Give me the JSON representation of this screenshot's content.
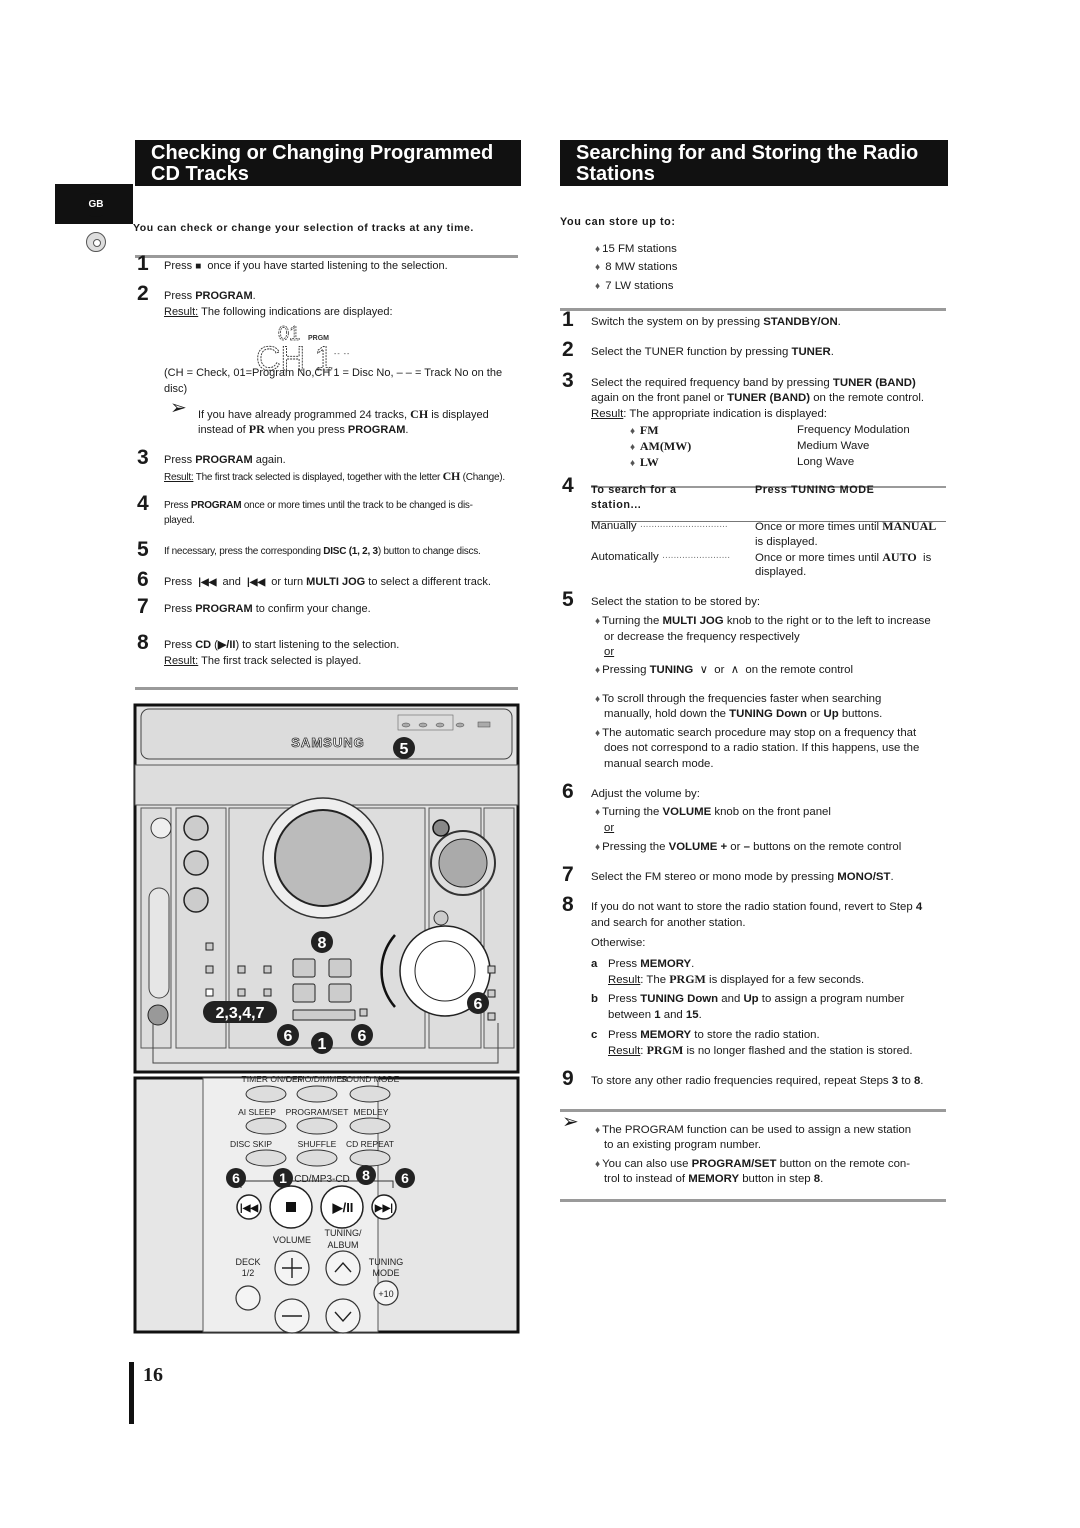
{
  "side": {
    "language_badge": "GB",
    "disc_icon": "cd-icon"
  },
  "left": {
    "title_line1": "Checking or Changing Programmed",
    "title_line2": "CD Tracks",
    "intro": "You can check or change your selection of tracks at any time.",
    "display": {
      "program_no": "01",
      "indicator": "PRGM",
      "check": "CH 1",
      "track": "-- --"
    },
    "lines": [
      [
        [
          "1",
          "num"
        ]
      ],
      [
        [
          "Press ",
          ""
        ],
        [
          "■",
          "icon"
        ],
        [
          "  once if you have started listening to the selection.",
          ""
        ]
      ],
      [
        [
          "2",
          "num"
        ]
      ],
      [
        [
          "Press ",
          ""
        ],
        [
          "PROGRAM",
          "b"
        ],
        [
          ".",
          ""
        ]
      ],
      [
        [
          "Result:",
          "u"
        ],
        [
          " The following indications are displayed:",
          ""
        ]
      ],
      [
        [
          "(CH = Check, 01=Program No,CH 1 = Disc No, – – = Track No on the",
          ""
        ]
      ],
      [
        [
          "disc)",
          ""
        ]
      ],
      [
        [
          "➢",
          "arrow"
        ]
      ],
      [
        [
          "If you have already programmed 24 tracks, ",
          ""
        ],
        [
          "CH",
          "sf"
        ],
        [
          " is displayed",
          ""
        ]
      ],
      [
        [
          "instead of ",
          ""
        ],
        [
          "PR",
          "sf"
        ],
        [
          " when you press ",
          ""
        ],
        [
          "PROGRAM",
          "b"
        ],
        [
          ".",
          ""
        ]
      ],
      [
        [
          "3",
          "num"
        ]
      ],
      [
        [
          "Press ",
          ""
        ],
        [
          "PROGRAM",
          "b"
        ],
        [
          " again.",
          ""
        ]
      ],
      [
        [
          "Result:",
          "u"
        ],
        [
          " The first track selected is displayed, together with the letter ",
          ""
        ],
        [
          "CH",
          "sf"
        ],
        [
          " (Change).",
          ""
        ]
      ],
      [
        [
          "4",
          "num"
        ]
      ],
      [
        [
          "Press ",
          ""
        ],
        [
          "PROGRAM",
          "b"
        ],
        [
          " once or more times until the track to be changed is dis-",
          ""
        ]
      ],
      [
        [
          "played.",
          ""
        ]
      ],
      [
        [
          "5",
          "num"
        ]
      ],
      [
        [
          "If necessary, press the corresponding ",
          ""
        ],
        [
          "DISC (1, 2, 3",
          "b"
        ],
        [
          ") button to change discs.",
          ""
        ]
      ],
      [
        [
          "6",
          "num"
        ]
      ],
      [
        [
          "Press  ",
          ""
        ],
        [
          "|◀◀",
          "icon"
        ],
        [
          "  and  ",
          ""
        ],
        [
          "|◀◀",
          "icon"
        ],
        [
          "  or turn ",
          ""
        ],
        [
          "MULTI JOG",
          "b"
        ],
        [
          " to select a different track.",
          ""
        ]
      ],
      [
        [
          "7",
          "num"
        ]
      ],
      [
        [
          "Press ",
          ""
        ],
        [
          "PROGRAM",
          "b"
        ],
        [
          " to confirm your change.",
          ""
        ]
      ],
      [
        [
          "8",
          "num"
        ]
      ],
      [
        [
          "Press ",
          ""
        ],
        [
          "CD",
          "b"
        ],
        [
          " (",
          ""
        ],
        [
          "▶/II",
          "b"
        ],
        [
          ") to start listening to the selection.",
          ""
        ]
      ],
      [
        [
          "Result:",
          "u"
        ],
        [
          " The first track selected is played.",
          ""
        ]
      ]
    ]
  },
  "device": {
    "brand": "SAMSUNG",
    "callouts": [
      "5",
      "8",
      "2,3,4,7",
      "6",
      "1",
      "6",
      "6"
    ]
  },
  "remote": {
    "row1": [
      "TIMER ON/OFF",
      "DEMO/DIMMER",
      "SOUND MODE"
    ],
    "row2": [
      "AI SLEEP",
      "PROGRAM/SET",
      "MEDLEY"
    ],
    "row3": [
      "DISC SKIP",
      "SHUFFLE",
      "CD REPEAT"
    ],
    "cd_label": "CD/MP3-CD",
    "callouts": [
      "6",
      "1",
      "8",
      "6"
    ],
    "volume": "VOLUME",
    "tuning_line1": "TUNING/",
    "tuning_line2": "ALBUM",
    "deck_line1": "DECK",
    "deck_line2": "1/2",
    "mode_line1": "TUNING",
    "mode_line2": "MODE",
    "plus10": "+10"
  },
  "right": {
    "title_line1": "Searching for and Storing the Radio",
    "title_line2": "Stations",
    "lines": [
      [
        [
          "You can store up to:",
          "hb"
        ]
      ],
      [
        [
          "♦",
          "dia"
        ],
        [
          "15 FM stations",
          ""
        ]
      ],
      [
        [
          "♦",
          "dia"
        ],
        [
          " 8 MW stations",
          ""
        ]
      ],
      [
        [
          "♦",
          "dia"
        ],
        [
          " 7 LW stations",
          ""
        ]
      ],
      [
        [
          "1",
          "num"
        ]
      ],
      [
        [
          "Switch the system on by pressing ",
          ""
        ],
        [
          "STANDBY/ON",
          "b"
        ],
        [
          ".",
          ""
        ]
      ],
      [
        [
          "2",
          "num"
        ]
      ],
      [
        [
          "Select the TUNER function by pressing ",
          ""
        ],
        [
          "TUNER",
          "b"
        ],
        [
          ".",
          ""
        ]
      ],
      [
        [
          "3",
          "num"
        ]
      ],
      [
        [
          "Select the required frequency band by pressing ",
          ""
        ],
        [
          "TUNER (BAND)",
          "b"
        ]
      ],
      [
        [
          "again on the front panel or ",
          ""
        ],
        [
          "TUNER (BAND)",
          "b"
        ],
        [
          " on the remote control.",
          ""
        ]
      ],
      [
        [
          "Result",
          "u"
        ],
        [
          ": The appropriate indication is displayed:",
          ""
        ]
      ],
      [
        [
          "♦ ",
          "dia"
        ],
        [
          "FM",
          "sf"
        ]
      ],
      [
        [
          "Frequency Modulation",
          ""
        ]
      ],
      [
        [
          "♦ ",
          "dia"
        ],
        [
          "AM(MW)",
          "sf"
        ]
      ],
      [
        [
          "Medium Wave",
          ""
        ]
      ],
      [
        [
          "♦ ",
          "dia"
        ],
        [
          "LW",
          "sf"
        ]
      ],
      [
        [
          "Long Wave",
          ""
        ]
      ],
      [
        [
          "4",
          "num"
        ]
      ],
      [
        [
          "To search for a",
          "hb"
        ]
      ],
      [
        [
          "station...",
          "hb"
        ]
      ],
      [
        [
          "Press TUNING MODE",
          "hb"
        ]
      ],
      [
        [
          "Manually ",
          ""
        ],
        [
          "·······························",
          "dots"
        ]
      ],
      [
        [
          "Once or more times until ",
          ""
        ],
        [
          "MANUAL",
          "sf"
        ]
      ],
      [
        [
          "is displayed.",
          ""
        ]
      ],
      [
        [
          "Automatically ",
          ""
        ],
        [
          "························",
          "dots"
        ]
      ],
      [
        [
          "Once or more times until ",
          ""
        ],
        [
          "AUTO",
          "sf"
        ],
        [
          "  is",
          ""
        ]
      ],
      [
        [
          "displayed.",
          ""
        ]
      ],
      [
        [
          "5",
          "num"
        ]
      ],
      [
        [
          "Select the station to be stored by:",
          ""
        ]
      ],
      [
        [
          "♦",
          "dia"
        ],
        [
          "Turning the ",
          ""
        ],
        [
          "MULTI JOG",
          "b"
        ],
        [
          " knob to the right or to the left to increase",
          ""
        ]
      ],
      [
        [
          "or decrease the frequency respectively",
          ""
        ]
      ],
      [
        [
          "or",
          "u"
        ]
      ],
      [
        [
          "♦",
          "dia"
        ],
        [
          "Pressing ",
          ""
        ],
        [
          "TUNING",
          "b"
        ],
        [
          "  ∨  or  ∧  on the remote control",
          ""
        ]
      ],
      [
        [
          "♦",
          "dia"
        ],
        [
          "To scroll through the frequencies faster when searching",
          ""
        ]
      ],
      [
        [
          "manually, hold down the ",
          ""
        ],
        [
          "TUNING Down",
          "b"
        ],
        [
          " or ",
          ""
        ],
        [
          "Up",
          "b"
        ],
        [
          " buttons.",
          ""
        ]
      ],
      [
        [
          "♦",
          "dia"
        ],
        [
          "The automatic search procedure may stop on a frequency that",
          ""
        ]
      ],
      [
        [
          "does not correspond to a radio station. If this happens, use the",
          ""
        ]
      ],
      [
        [
          "manual search mode.",
          ""
        ]
      ],
      [
        [
          "6",
          "num"
        ]
      ],
      [
        [
          "Adjust the volume by:",
          ""
        ]
      ],
      [
        [
          "♦",
          "dia"
        ],
        [
          "Turning the ",
          ""
        ],
        [
          "VOLUME",
          "b"
        ],
        [
          " knob on the front panel",
          ""
        ]
      ],
      [
        [
          "or",
          "u"
        ]
      ],
      [
        [
          "♦",
          "dia"
        ],
        [
          "Pressing the ",
          ""
        ],
        [
          "VOLUME +",
          "b"
        ],
        [
          " or ",
          ""
        ],
        [
          "–",
          "b"
        ],
        [
          " buttons on the remote control",
          ""
        ]
      ],
      [
        [
          "7",
          "num"
        ]
      ],
      [
        [
          "Select the FM stereo or mono mode by pressing ",
          ""
        ],
        [
          "MONO/ST",
          "b"
        ],
        [
          ".",
          ""
        ]
      ],
      [
        [
          "8",
          "num"
        ]
      ],
      [
        [
          "If you do not want to store the radio station found, revert to Step ",
          ""
        ],
        [
          "4",
          "b"
        ]
      ],
      [
        [
          "and search for another station.",
          ""
        ]
      ],
      [
        [
          "Otherwise:",
          ""
        ]
      ],
      [
        [
          "a",
          "b"
        ]
      ],
      [
        [
          "Press ",
          ""
        ],
        [
          "MEMORY",
          "b"
        ],
        [
          ".",
          ""
        ]
      ],
      [
        [
          "Result",
          "u"
        ],
        [
          ": The ",
          ""
        ],
        [
          "PRGM",
          "sf"
        ],
        [
          " is displayed for a few seconds.",
          ""
        ]
      ],
      [
        [
          "b",
          "b"
        ]
      ],
      [
        [
          "Press ",
          ""
        ],
        [
          "TUNING Down",
          "b"
        ],
        [
          " and ",
          ""
        ],
        [
          "Up",
          "b"
        ],
        [
          " to assign a program number",
          ""
        ]
      ],
      [
        [
          "between ",
          ""
        ],
        [
          "1",
          "b"
        ],
        [
          " and ",
          ""
        ],
        [
          "15",
          "b"
        ],
        [
          ".",
          ""
        ]
      ],
      [
        [
          "c",
          "b"
        ]
      ],
      [
        [
          "Press ",
          ""
        ],
        [
          "MEMORY",
          "b"
        ],
        [
          " to store the radio station.",
          ""
        ]
      ],
      [
        [
          "Result",
          "u"
        ],
        [
          ": ",
          ""
        ],
        [
          "PRGM",
          "sf"
        ],
        [
          " is no longer flashed and the station is stored.",
          ""
        ]
      ],
      [
        [
          "9",
          "num"
        ]
      ],
      [
        [
          "To store any other radio frequencies required, repeat Steps ",
          ""
        ],
        [
          "3",
          "b"
        ],
        [
          " to ",
          ""
        ],
        [
          "8",
          "b"
        ],
        [
          ".",
          ""
        ]
      ],
      [
        [
          "➢",
          "arrow"
        ]
      ],
      [
        [
          "♦",
          "dia"
        ],
        [
          "The PROGRAM function can be used to assign a new station",
          ""
        ]
      ],
      [
        [
          "to an existing program number.",
          ""
        ]
      ],
      [
        [
          "♦",
          "dia"
        ],
        [
          "You can also use ",
          ""
        ],
        [
          "PROGRAM/SET",
          "b"
        ],
        [
          " button on the remote con-",
          ""
        ]
      ],
      [
        [
          "trol to instead of ",
          ""
        ],
        [
          "MEMORY",
          "b"
        ],
        [
          " button in step ",
          ""
        ],
        [
          "8",
          "b"
        ],
        [
          ".",
          ""
        ]
      ]
    ]
  },
  "footer": {
    "page_number": "16"
  }
}
